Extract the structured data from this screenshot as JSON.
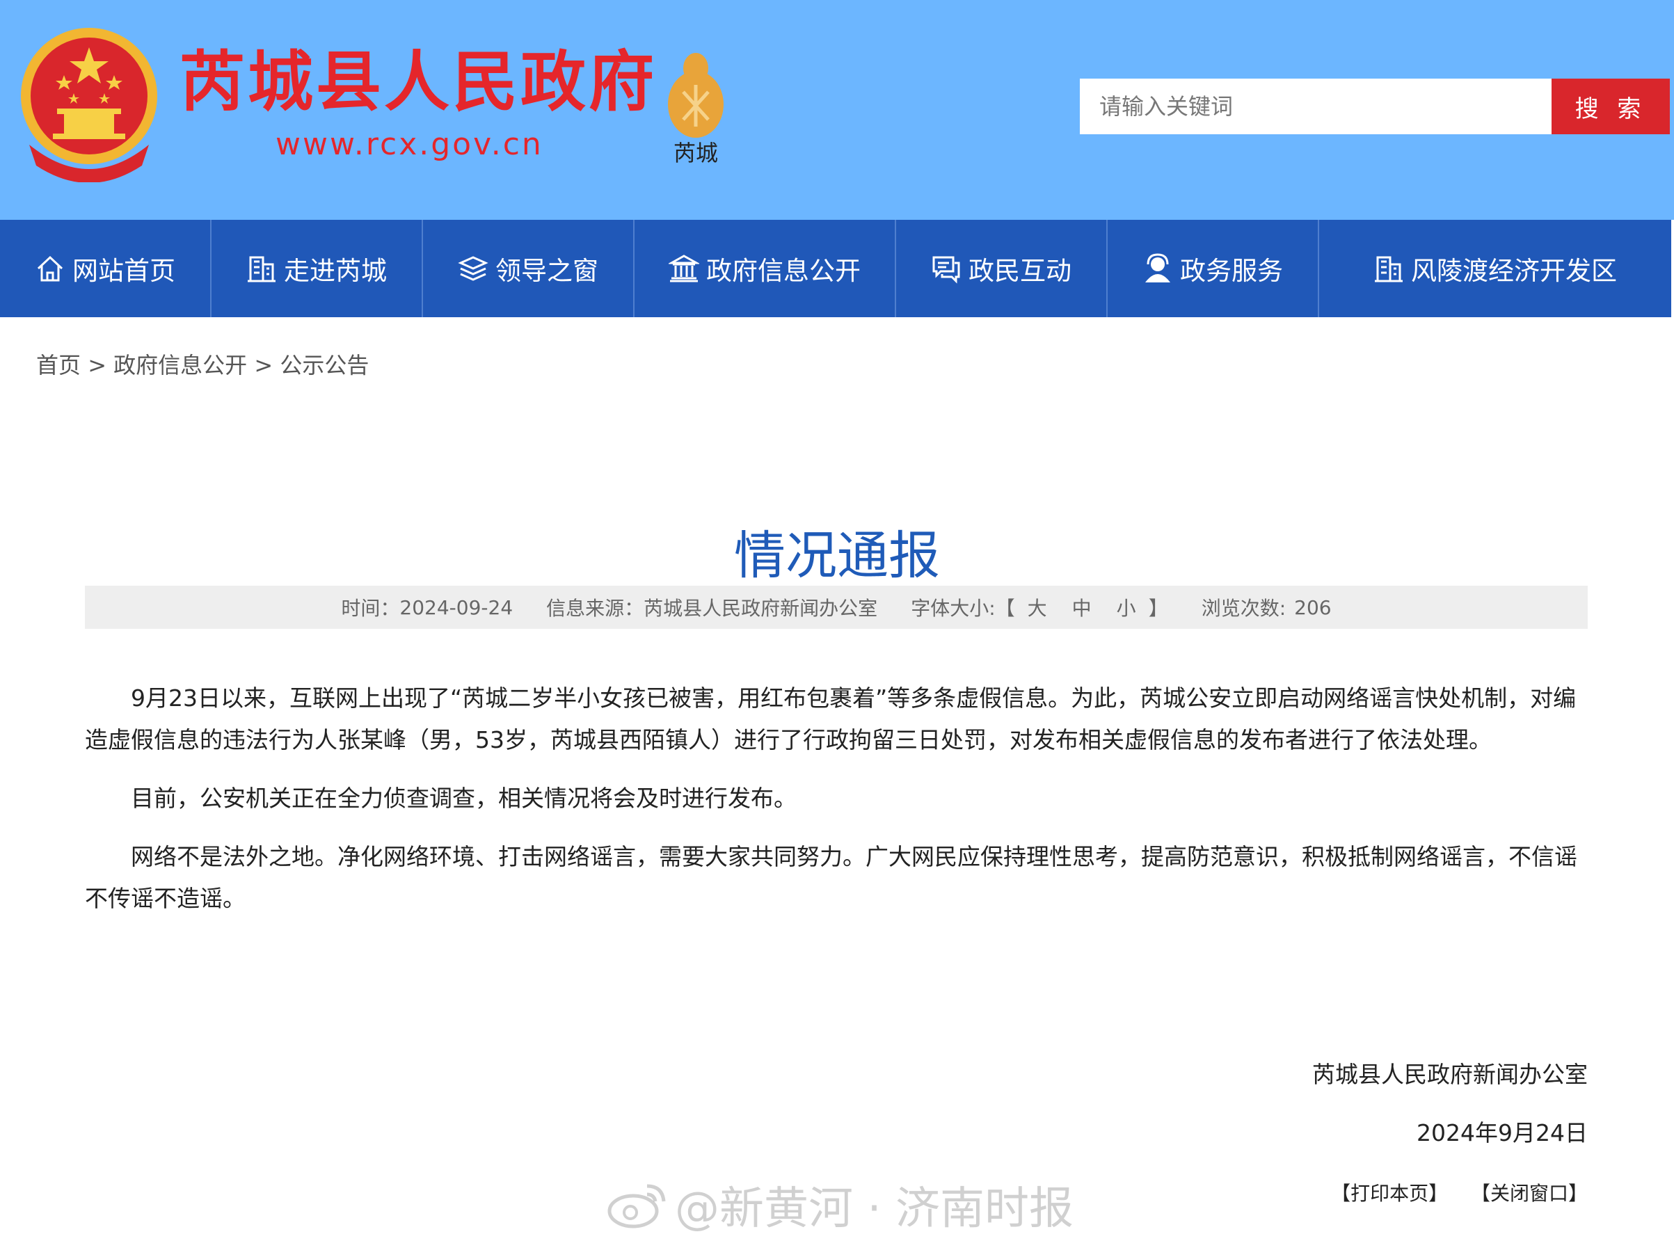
{
  "header": {
    "site_title": "芮城县人民政府",
    "site_url": "www.rcx.gov.cn",
    "city_logo_text": "芮城",
    "search": {
      "placeholder": "请输入关键词",
      "button_label": "搜 索"
    }
  },
  "nav": {
    "items": [
      {
        "label": "网站首页",
        "icon": "home-icon"
      },
      {
        "label": "走进芮城",
        "icon": "building-icon"
      },
      {
        "label": "领导之窗",
        "icon": "layers-icon"
      },
      {
        "label": "政府信息公开",
        "icon": "government-icon"
      },
      {
        "label": "政民互动",
        "icon": "chat-icon"
      },
      {
        "label": "政务服务",
        "icon": "user-service-icon"
      },
      {
        "label": "风陵渡经济开发区",
        "icon": "building-icon"
      }
    ]
  },
  "breadcrumb": {
    "home": "首页",
    "sep": ">",
    "level1": "政府信息公开",
    "level2": "公示公告"
  },
  "article": {
    "title": "情况通报",
    "meta": {
      "time_label": "时间：",
      "time": "2024-09-24",
      "source_label": "信息来源：",
      "source": "芮城县人民政府新闻办公室",
      "font_size_label": "字体大小:",
      "bracket_open": "【",
      "bracket_close": "】",
      "font_large": "大",
      "font_medium": "中",
      "font_small": "小",
      "views_label": "浏览次数:",
      "views": "206"
    },
    "paragraphs": [
      "9月23日以来，互联网上出现了“芮城二岁半小女孩已被害，用红布包裹着”等多条虚假信息。为此，芮城公安立即启动网络谣言快处机制，对编造虚假信息的违法行为人张某峰（男，53岁，芮城县西陌镇人）进行了行政拘留三日处罚，对发布相关虚假信息的发布者进行了依法处理。",
      "目前，公安机关正在全力侦查调查，相关情况将会及时进行发布。",
      "网络不是法外之地。净化网络环境、打击网络谣言，需要大家共同努力。广大网民应保持理性思考，提高防范意识，积极抵制网络谣言，不信谣不传谣不造谣。"
    ],
    "signature": "芮城县人民政府新闻办公室",
    "date": "2024年9月24日"
  },
  "actions": {
    "print": "【打印本页】",
    "close": "【关闭窗口】"
  },
  "watermark": {
    "text": "@新黄河 · 济南时报",
    "icon": "weibo-icon"
  },
  "colors": {
    "header_bg": "#6cb6ff",
    "nav_bg": "#2058b8",
    "title_red": "#e5262b",
    "article_title_blue": "#1f5bb8",
    "search_btn": "#d9262c"
  }
}
